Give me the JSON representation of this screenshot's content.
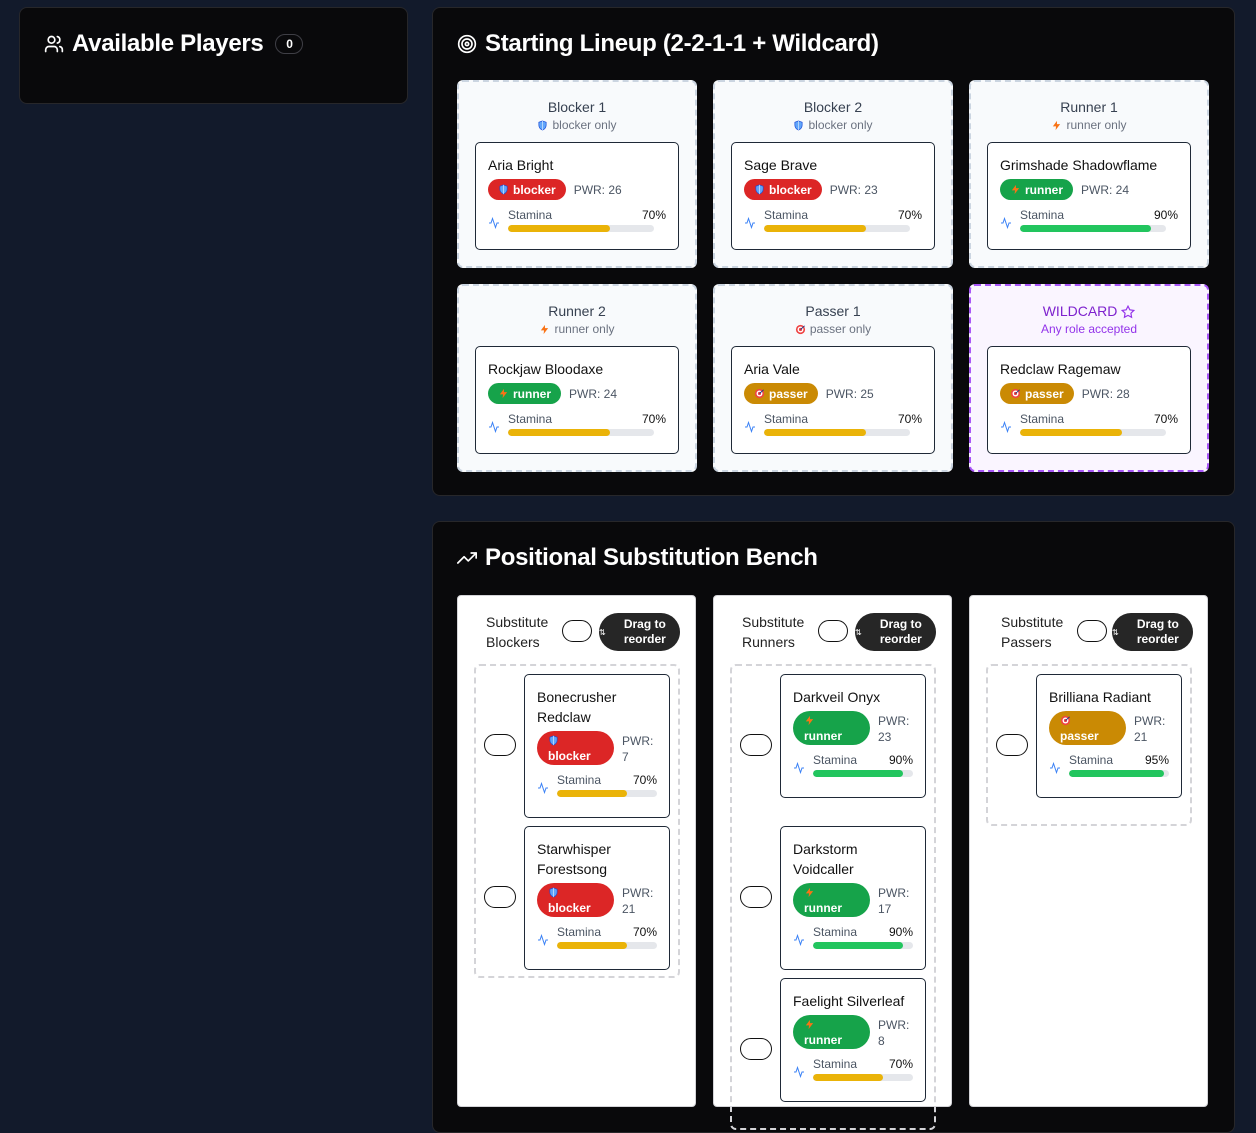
{
  "available": {
    "title": "Available Players",
    "count": "0"
  },
  "lineup": {
    "title": "Starting Lineup (2-2-1-1 + Wildcard)",
    "slots": [
      {
        "title": "Blocker 1",
        "sub": "blocker only",
        "player": {
          "name": "Aria Bright",
          "role": "blocker",
          "pwr": "PWR: 26",
          "stamina_label": "Stamina",
          "stamina": "70%",
          "stamina_value": 0.7
        }
      },
      {
        "title": "Blocker 2",
        "sub": "blocker only",
        "player": {
          "name": "Sage Brave",
          "role": "blocker",
          "pwr": "PWR: 23",
          "stamina_label": "Stamina",
          "stamina": "70%",
          "stamina_value": 0.7
        }
      },
      {
        "title": "Runner 1",
        "sub": "runner only",
        "player": {
          "name": "Grimshade Shadowflame",
          "role": "runner",
          "pwr": "PWR: 24",
          "stamina_label": "Stamina",
          "stamina": "90%",
          "stamina_value": 0.9
        }
      },
      {
        "title": "Runner 2",
        "sub": "runner only",
        "player": {
          "name": "Rockjaw Bloodaxe",
          "role": "runner",
          "pwr": "PWR: 24",
          "stamina_label": "Stamina",
          "stamina": "70%",
          "stamina_value": 0.7
        }
      },
      {
        "title": "Passer 1",
        "sub": "passer only",
        "player": {
          "name": "Aria Vale",
          "role": "passer",
          "pwr": "PWR: 25",
          "stamina_label": "Stamina",
          "stamina": "70%",
          "stamina_value": 0.7
        }
      },
      {
        "title": "WILDCARD",
        "sub": "Any role accepted",
        "player": {
          "name": "Redclaw Ragemaw",
          "role": "passer",
          "pwr": "PWR: 28",
          "stamina_label": "Stamina",
          "stamina": "70%",
          "stamina_value": 0.7
        }
      }
    ]
  },
  "bench": {
    "title": "Positional Substitution Bench",
    "drag_label": "Drag to reorder",
    "columns": [
      {
        "heading": "Substitute Blockers",
        "players": [
          {
            "name": "Bonecrusher Redclaw",
            "role": "blocker",
            "pwr_label": "PWR:",
            "pwr": "7",
            "stamina_label": "Stamina",
            "stamina": "70%",
            "stamina_value": 0.7
          },
          {
            "name": "Starwhisper Forestsong",
            "role": "blocker",
            "pwr_label": "PWR:",
            "pwr": "21",
            "stamina_label": "Stamina",
            "stamina": "70%",
            "stamina_value": 0.7
          }
        ]
      },
      {
        "heading": "Substitute Runners",
        "players": [
          {
            "name": "Darkveil Onyx",
            "role": "runner",
            "pwr_label": "PWR:",
            "pwr": "23",
            "stamina_label": "Stamina",
            "stamina": "90%",
            "stamina_value": 0.9
          },
          {
            "name": "Darkstorm Voidcaller",
            "role": "runner",
            "pwr_label": "PWR:",
            "pwr": "17",
            "stamina_label": "Stamina",
            "stamina": "90%",
            "stamina_value": 0.9
          },
          {
            "name": "Faelight Silverleaf",
            "role": "runner",
            "pwr_label": "PWR:",
            "pwr": "8",
            "stamina_label": "Stamina",
            "stamina": "70%",
            "stamina_value": 0.7
          }
        ]
      },
      {
        "heading": "Substitute Passers",
        "players": [
          {
            "name": "Brilliana Radiant",
            "role": "passer",
            "pwr_label": "PWR:",
            "pwr": "21",
            "stamina_label": "Stamina",
            "stamina": "95%",
            "stamina_value": 0.95
          }
        ]
      }
    ]
  },
  "colors": {
    "blocker": "#dc2626",
    "runner": "#16a34a",
    "passer": "#ca8a04",
    "stamina_high": "#22c55e",
    "stamina_mid": "#eab308",
    "wildcard": "#9333ea"
  },
  "icons": {
    "blocker": "shield-icon",
    "runner": "bolt-icon",
    "passer": "target-icon",
    "stamina": "activity-icon",
    "wildcard": "star-icon"
  }
}
